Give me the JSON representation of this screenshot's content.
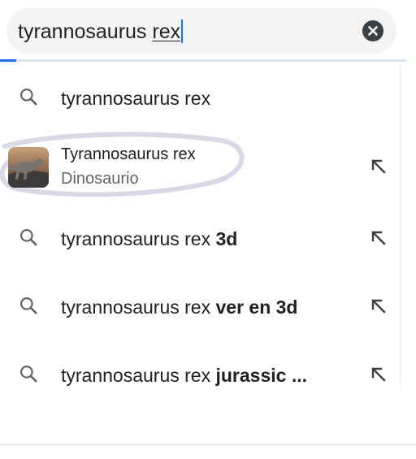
{
  "search": {
    "query_plain": "tyrannosaurus ",
    "query_underlined": "rex"
  },
  "progress_fraction": 0.04,
  "suggestions": [
    {
      "type": "query",
      "base": "tyrannosaurus rex",
      "bold": ""
    },
    {
      "type": "entity",
      "title": "Tyrannosaurus rex",
      "subtitle": "Dinosaurio"
    },
    {
      "type": "query",
      "base": "tyrannosaurus rex ",
      "bold": "3d"
    },
    {
      "type": "query",
      "base": "tyrannosaurus rex ",
      "bold": "ver en 3d"
    },
    {
      "type": "query",
      "base": "tyrannosaurus rex ",
      "bold": "jurassic ..."
    }
  ],
  "icons": {
    "search": "search-icon",
    "clear": "close-icon",
    "fill": "arrow-up-left-icon",
    "thumbnail": "dinosaur-thumbnail"
  },
  "colors": {
    "accent": "#1a73e8",
    "search_bg": "#f1f3f4",
    "icon": "#5f6368",
    "annotation": "#d8d8e6"
  }
}
